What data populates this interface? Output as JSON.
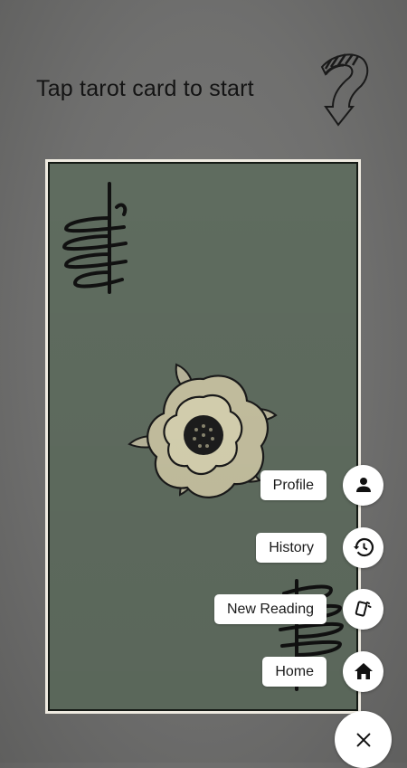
{
  "header": {
    "instruction": "Tap tarot card to start"
  },
  "card": {
    "icon": "ace-of-pentacles-rose-card"
  },
  "menu": {
    "items": [
      {
        "label": "Profile",
        "icon": "person-icon"
      },
      {
        "label": "History",
        "icon": "history-icon"
      },
      {
        "label": "New Reading",
        "icon": "cards-icon"
      },
      {
        "label": "Home",
        "icon": "home-icon"
      }
    ],
    "close_icon": "close-icon"
  },
  "colors": {
    "background": "#6f6f6e",
    "card_green": "#5f6c5f",
    "label_bg": "#ffffff"
  }
}
